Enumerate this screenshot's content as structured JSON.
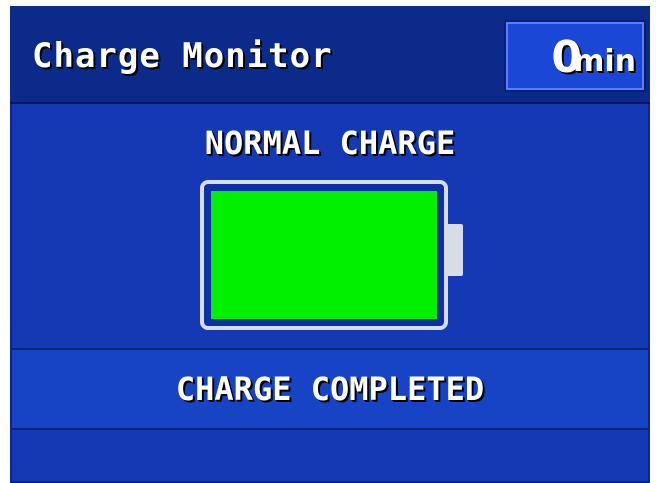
{
  "header": {
    "title": "Charge Monitor",
    "timer_value": "0",
    "timer_unit": "min"
  },
  "charge_mode": "NORMAL CHARGE",
  "battery": {
    "level_percent": 100,
    "fill_color": "#00f000",
    "outline_color": "#d8dce6"
  },
  "status_message": "CHARGE COMPLETED",
  "colors": {
    "background": "#1538b4",
    "header_background": "#0b2a8a",
    "text": "#ffffff"
  }
}
